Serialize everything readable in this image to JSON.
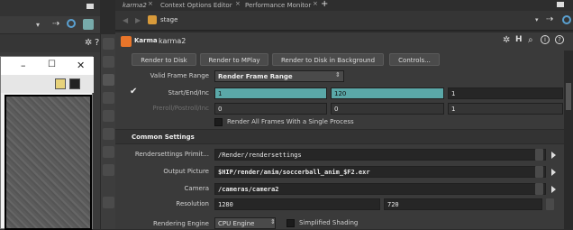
{
  "tabs": [
    {
      "label": "karma2"
    },
    {
      "label": "Context Options Editor"
    },
    {
      "label": "Performance Monitor"
    }
  ],
  "path": {
    "label": "stage"
  },
  "node": {
    "type": "Karma",
    "name": "karma2"
  },
  "buttons": {
    "render_to_disk": "Render to Disk",
    "render_to_mplay": "Render to MPlay",
    "render_to_disk_bg": "Render to Disk in Background",
    "controls": "Controls..."
  },
  "frame": {
    "valid_label": "Valid Frame Range",
    "valid_value": "Render Frame Range",
    "start_label": "Start/End/Inc",
    "start": "1",
    "end": "120",
    "inc": "1",
    "preroll_label": "Preroll/Postroll/Inc",
    "preroll": "0",
    "postroll": "0",
    "preroll_inc": "1",
    "single_process_label": "Render All Frames With a Single Process"
  },
  "common": {
    "header": "Common Settings",
    "rendersettings_label": "Rendersettings Primit...",
    "rendersettings_value": "/Render/rendersettings",
    "output_label": "Output Picture",
    "output_value": "$HIP/render/anim/soccerball_anim_$F2.exr",
    "camera_label": "Camera",
    "camera_value": "/cameras/camera2",
    "resolution_label": "Resolution",
    "res_x": "1280",
    "res_y": "720",
    "engine_label": "Rendering Engine",
    "engine_value": "CPU Engine",
    "simplified_label": "Simplified Shading"
  },
  "colors": {
    "teal": "#5aa8a8",
    "accent": "#f08a24"
  }
}
